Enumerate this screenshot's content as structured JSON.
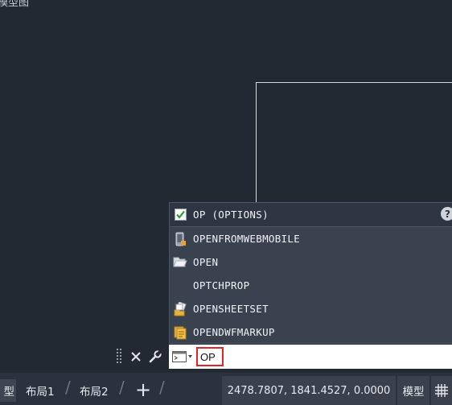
{
  "canvas": {
    "corner_label": "模型图"
  },
  "autocomplete": {
    "header": {
      "label": "OP (OPTIONS)",
      "icon": "checkbox-checked-icon",
      "help_icon": "help-icon"
    },
    "items": [
      {
        "label": "OPENFROMWEBMOBILE",
        "icon": "mobile-device-icon"
      },
      {
        "label": "OPEN",
        "icon": "folder-open-icon"
      },
      {
        "label": "OPTCHPROP",
        "icon": ""
      },
      {
        "label": "OPENSHEETSET",
        "icon": "sheetset-icon"
      },
      {
        "label": "OPENDWFMARKUP",
        "icon": "dwf-markup-icon"
      }
    ]
  },
  "command_line": {
    "input_value": "OP",
    "close_icon": "close-icon",
    "settings_icon": "wrench-icon",
    "prompt_icon": "command-prompt-icon"
  },
  "status_bar": {
    "tabs": [
      {
        "label": "型"
      },
      {
        "label": "布局1"
      },
      {
        "label": "布局2"
      }
    ],
    "add_tab": "+",
    "coordinates": "2478.7807, 1841.4527, 0.0000",
    "model_button": "模型",
    "grid_icon": "grid-icon"
  },
  "colors": {
    "background": "#222933",
    "popup_bg": "#3a4250",
    "input_highlight": "#e0262b"
  }
}
